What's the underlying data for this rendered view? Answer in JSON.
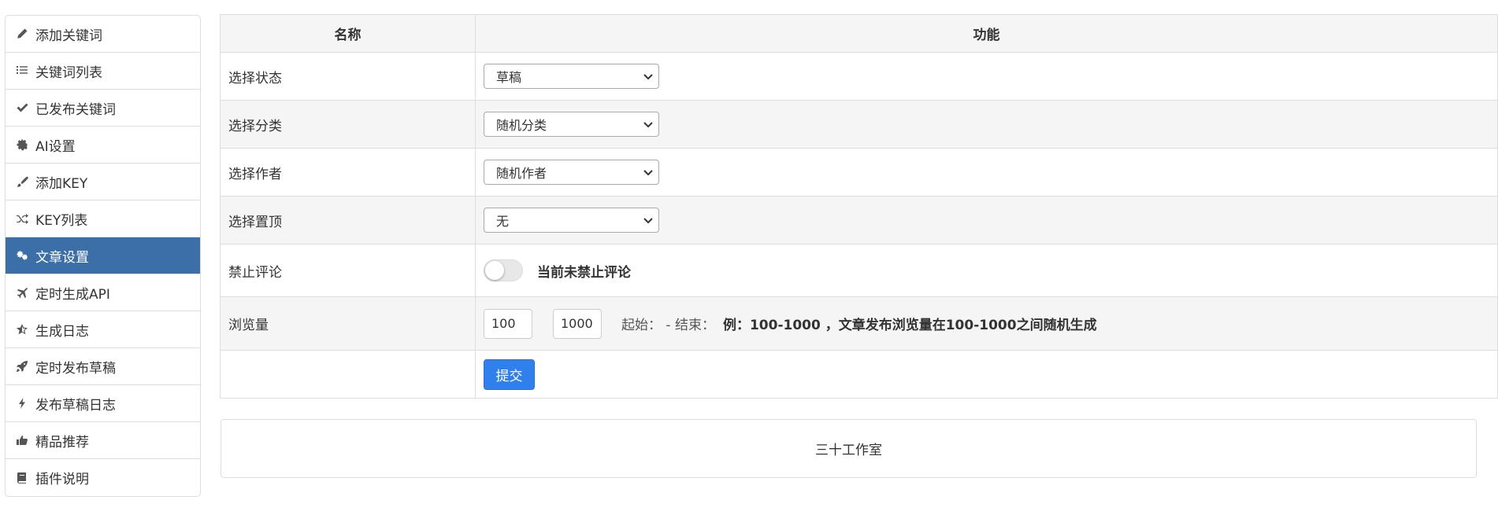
{
  "sidebar": {
    "items": [
      {
        "label": "添加关键词",
        "icon": "pencil-icon",
        "active": false
      },
      {
        "label": "关键词列表",
        "icon": "list-icon",
        "active": false
      },
      {
        "label": "已发布关键词",
        "icon": "check-icon",
        "active": false
      },
      {
        "label": "AI设置",
        "icon": "gear-icon",
        "active": false
      },
      {
        "label": "添加KEY",
        "icon": "brush-icon",
        "active": false
      },
      {
        "label": "KEY列表",
        "icon": "shuffle-icon",
        "active": false
      },
      {
        "label": "文章设置",
        "icon": "gears-icon",
        "active": true
      },
      {
        "label": "定时生成API",
        "icon": "plane-icon",
        "active": false
      },
      {
        "label": "生成日志",
        "icon": "star-half-icon",
        "active": false
      },
      {
        "label": "定时发布草稿",
        "icon": "rocket-icon",
        "active": false
      },
      {
        "label": "发布草稿日志",
        "icon": "bolt-icon",
        "active": false
      },
      {
        "label": "精品推荐",
        "icon": "thumbs-up-icon",
        "active": false
      },
      {
        "label": "插件说明",
        "icon": "book-icon",
        "active": false
      }
    ],
    "active_color": "#3c6ea7"
  },
  "table": {
    "header_name": "名称",
    "header_func": "功能",
    "rows": {
      "status": {
        "label": "选择状态",
        "value": "草稿"
      },
      "category": {
        "label": "选择分类",
        "value": "随机分类"
      },
      "author": {
        "label": "选择作者",
        "value": "随机作者"
      },
      "sticky": {
        "label": "选择置顶",
        "value": "无"
      },
      "comments": {
        "label": "禁止评论",
        "toggle_text": "当前未禁止评论",
        "toggle_on": false
      },
      "views": {
        "label": "浏览量",
        "start_value": "100",
        "end_value": "1000",
        "range_text": "起始： - 结束：",
        "hint": "例：100-1000 ，文章发布浏览量在100-1000之间随机生成"
      }
    },
    "submit_label": "提交"
  },
  "footer": {
    "text": "三十工作室"
  },
  "colors": {
    "accent": "#2f80ed",
    "stripe": "#f5f5f5",
    "border": "#dddddd"
  }
}
